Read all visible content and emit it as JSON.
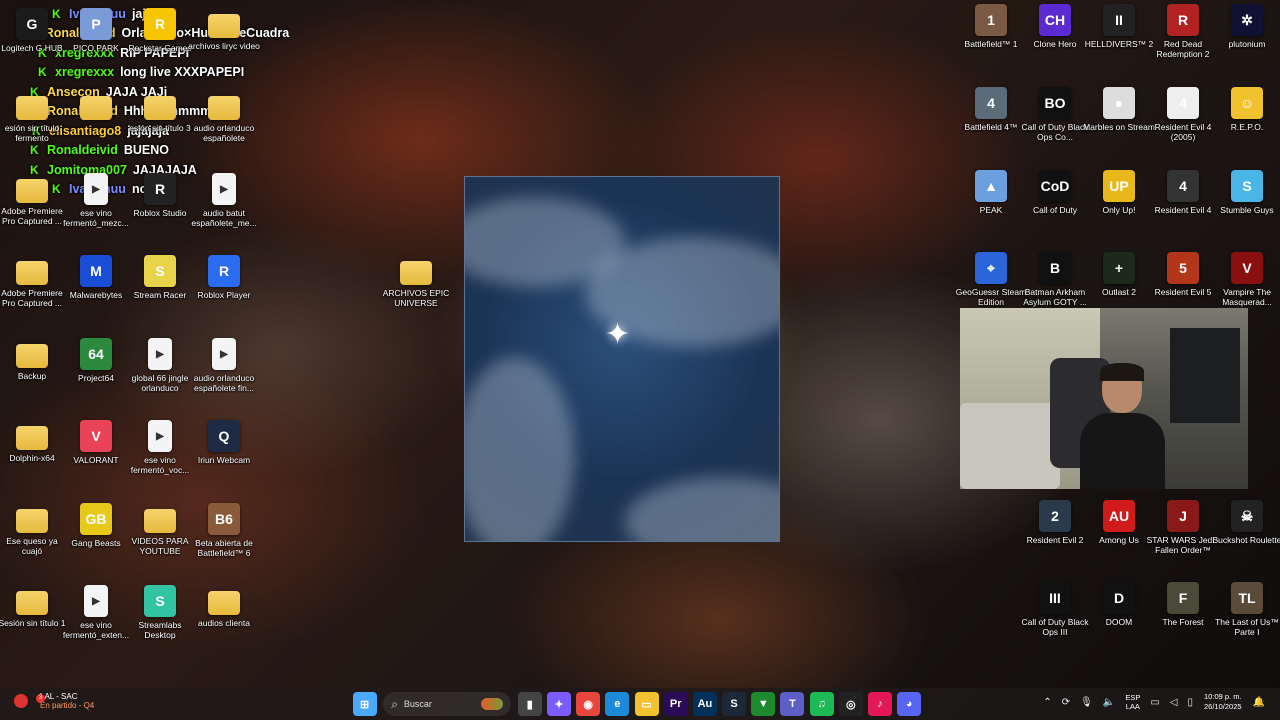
{
  "chat": [
    {
      "user": "IvanAnuu",
      "user_color": "#7b8cff",
      "message": "jajajaja"
    },
    {
      "user": "Ronaldeivid",
      "user_color": "#ffd84a",
      "message": "Orlanduco×HumordeCuadra"
    },
    {
      "user": "xregrexxx",
      "user_color": "#53fc18",
      "message": "RIP PAPEPI"
    },
    {
      "user": "xregrexxx",
      "user_color": "#53fc18",
      "message": "long live XXXPAPEPI"
    },
    {
      "user": "Ansecon",
      "user_color": "#ffd84a",
      "message": "JAJA JAJi"
    },
    {
      "user": "Ronaldeivid",
      "user_color": "#ffd84a",
      "message": "Hhhhmmmmm"
    },
    {
      "user": "elisantiago8",
      "user_color": "#ffcc33",
      "message": "jajajaja"
    },
    {
      "user": "Ronaldeivid",
      "user_color": "#53fc18",
      "message": "BUENO"
    },
    {
      "user": "Jomitoma007",
      "user_color": "#53fc18",
      "message": "JAJAJAJA"
    },
    {
      "user": "IvanAnuu",
      "user_color": "#7b8cff",
      "message": "noo"
    }
  ],
  "left_icons": [
    {
      "label": "Logitech G HUB",
      "color": "#1b1b1b",
      "glyph": "G"
    },
    {
      "label": "PICO PARK",
      "color": "#7a9bd8",
      "glyph": "P"
    },
    {
      "label": "Rockstar Games",
      "color": "#f7c500",
      "glyph": "R"
    },
    {
      "label": "archivos liryc video",
      "color": "folder",
      "glyph": ""
    },
    {
      "label": "esión sin título fermento",
      "color": "folder",
      "glyph": ""
    },
    {
      "label": "",
      "color": "folder",
      "glyph": ""
    },
    {
      "label": "esión sin título 3",
      "color": "folder",
      "glyph": ""
    },
    {
      "label": "audio orlanduco españolete",
      "color": "folder",
      "glyph": ""
    },
    {
      "label": "Adobe Premiere Pro Captured ...",
      "color": "folder",
      "glyph": ""
    },
    {
      "label": "ese vino fermentó_mezc...",
      "color": "media",
      "glyph": ""
    },
    {
      "label": "Roblox Studio",
      "color": "#222",
      "glyph": "R"
    },
    {
      "label": "audio batut españolete_me...",
      "color": "media",
      "glyph": ""
    },
    {
      "label": "Adobe Premiere Pro Captured ...",
      "color": "folder",
      "glyph": ""
    },
    {
      "label": "Malwarebytes",
      "color": "#1a4dd6",
      "glyph": "M"
    },
    {
      "label": "Stream Racer",
      "color": "#e8d44a",
      "glyph": "S"
    },
    {
      "label": "Roblox Player",
      "color": "#2a6bf0",
      "glyph": "R"
    },
    {
      "label": "ARCHIVOS EPIC UNIVERSE",
      "color": "folder",
      "glyph": ""
    },
    {
      "label": "Backup",
      "color": "folder",
      "glyph": ""
    },
    {
      "label": "Project64",
      "color": "#2b8a3e",
      "glyph": "64"
    },
    {
      "label": "global 66 jingle orlanduco",
      "color": "media",
      "glyph": ""
    },
    {
      "label": "audio orlanduco españolete fin...",
      "color": "media",
      "glyph": ""
    },
    {
      "label": "Dolphin-x64",
      "color": "folder",
      "glyph": ""
    },
    {
      "label": "VALORANT",
      "color": "#e84356",
      "glyph": "V"
    },
    {
      "label": "ese vino fermentó_voc...",
      "color": "media",
      "glyph": ""
    },
    {
      "label": "Iriun Webcam",
      "color": "#1f2a44",
      "glyph": "Q"
    },
    {
      "label": "Ese queso ya cuajó",
      "color": "folder",
      "glyph": ""
    },
    {
      "label": "Gang Beasts",
      "color": "#e8c91a",
      "glyph": "GB"
    },
    {
      "label": "VIDEOS PARA YOUTUBE",
      "color": "folder",
      "glyph": ""
    },
    {
      "label": "Beta abierta de Battlefield™ 6",
      "color": "#8a5a3a",
      "glyph": "B6"
    },
    {
      "label": "Sesión sin título 1",
      "color": "folder",
      "glyph": ""
    },
    {
      "label": "ese vino fermentó_exten...",
      "color": "media",
      "glyph": ""
    },
    {
      "label": "Streamlabs Desktop",
      "color": "#31c3a2",
      "glyph": "S"
    },
    {
      "label": "audios clienta",
      "color": "folder",
      "glyph": ""
    }
  ],
  "right_icons": [
    {
      "label": "Battlefield™ 1",
      "color": "#7a5a45",
      "glyph": "1"
    },
    {
      "label": "Clone Hero",
      "color": "#5b2bd1",
      "glyph": "CH"
    },
    {
      "label": "HELLDIVERS™ 2",
      "color": "#222",
      "glyph": "II"
    },
    {
      "label": "Red Dead Redemption 2",
      "color": "#b32222",
      "glyph": "R"
    },
    {
      "label": "plutonium",
      "color": "#113",
      "glyph": "✲"
    },
    {
      "label": "Battlefield 4™",
      "color": "#5a6b7a",
      "glyph": "4"
    },
    {
      "label": "Call of Duty Black Ops Co...",
      "color": "#111",
      "glyph": "BO"
    },
    {
      "label": "Marbles on Stream",
      "color": "#ddd",
      "glyph": "●"
    },
    {
      "label": "Resident Evil 4 (2005)",
      "color": "#eee",
      "glyph": "4"
    },
    {
      "label": "R.E.P.O.",
      "color": "#f2c12e",
      "glyph": "☺"
    },
    {
      "label": "PEAK",
      "color": "#6aa0e0",
      "glyph": "▲"
    },
    {
      "label": "Call of Duty",
      "color": "#111",
      "glyph": "CoD"
    },
    {
      "label": "Only Up!",
      "color": "#e8b81a",
      "glyph": "UP"
    },
    {
      "label": "Resident Evil 4",
      "color": "#333",
      "glyph": "4"
    },
    {
      "label": "Stumble Guys",
      "color": "#4ab6e8",
      "glyph": "S"
    },
    {
      "label": "GeoGuessr Steam Edition",
      "color": "#2a66d8",
      "glyph": "⌖"
    },
    {
      "label": "Batman Arkham Asylum GOTY ...",
      "color": "#111",
      "glyph": "B"
    },
    {
      "label": "Outlast 2",
      "color": "#1b2a1b",
      "glyph": "+"
    },
    {
      "label": "Resident Evil 5",
      "color": "#b3351a",
      "glyph": "5"
    },
    {
      "label": "Vampire The Masquerad...",
      "color": "#8a1010",
      "glyph": "V"
    },
    {
      "label": "Resident Evil 2",
      "color": "#2a3a4a",
      "glyph": "2"
    },
    {
      "label": "Among Us",
      "color": "#d11a1a",
      "glyph": "AU"
    },
    {
      "label": "STAR WARS Jedi - Fallen Order™",
      "color": "#8a1a1a",
      "glyph": "J"
    },
    {
      "label": "Buckshot Roulette",
      "color": "#222",
      "glyph": "☠"
    },
    {
      "label": "Call of Duty Black Ops III",
      "color": "#111",
      "glyph": "III"
    },
    {
      "label": "DOOM",
      "color": "#111",
      "glyph": "D"
    },
    {
      "label": "The Forest",
      "color": "#4a4a3a",
      "glyph": "F"
    },
    {
      "label": "The Last of Us™ Parte I",
      "color": "#5a4a3a",
      "glyph": "TL"
    }
  ],
  "taskbar": {
    "weather_title": "LAL - SAC",
    "weather_sub": "En partido - Q4",
    "weather_badge": "3",
    "search_placeholder": "Buscar",
    "apps": [
      {
        "name": "start-button",
        "glyph": "⊞",
        "color": "#4aa8ff"
      },
      {
        "name": "task-view-button",
        "glyph": "▮",
        "color": "#444"
      },
      {
        "name": "copilot-button",
        "glyph": "✦",
        "color": "#7a5cff"
      },
      {
        "name": "chrome-button",
        "glyph": "◉",
        "color": "#e8453c"
      },
      {
        "name": "edge-button",
        "glyph": "e",
        "color": "#1c8ad8"
      },
      {
        "name": "file-explorer-button",
        "glyph": "▭",
        "color": "#f2c230"
      },
      {
        "name": "premiere-button",
        "glyph": "Pr",
        "color": "#2b0b57"
      },
      {
        "name": "audition-button",
        "glyph": "Au",
        "color": "#00315a"
      },
      {
        "name": "steam-button",
        "glyph": "S",
        "color": "#1b2838"
      },
      {
        "name": "razer-button",
        "glyph": "▼",
        "color": "#1d8a2d"
      },
      {
        "name": "teams-button",
        "glyph": "T",
        "color": "#5b5fc7"
      },
      {
        "name": "spotify-button",
        "glyph": "♫",
        "color": "#1db954"
      },
      {
        "name": "ai-app-button",
        "glyph": "◎",
        "color": "#222"
      },
      {
        "name": "tiktok-button",
        "glyph": "♪",
        "color": "#e2185b"
      },
      {
        "name": "discord-button",
        "glyph": "◕",
        "color": "#5865f2"
      }
    ],
    "lang_top": "ESP",
    "lang_bottom": "LAA",
    "time": "10:09 p. m.",
    "date": "26/10/2025"
  }
}
